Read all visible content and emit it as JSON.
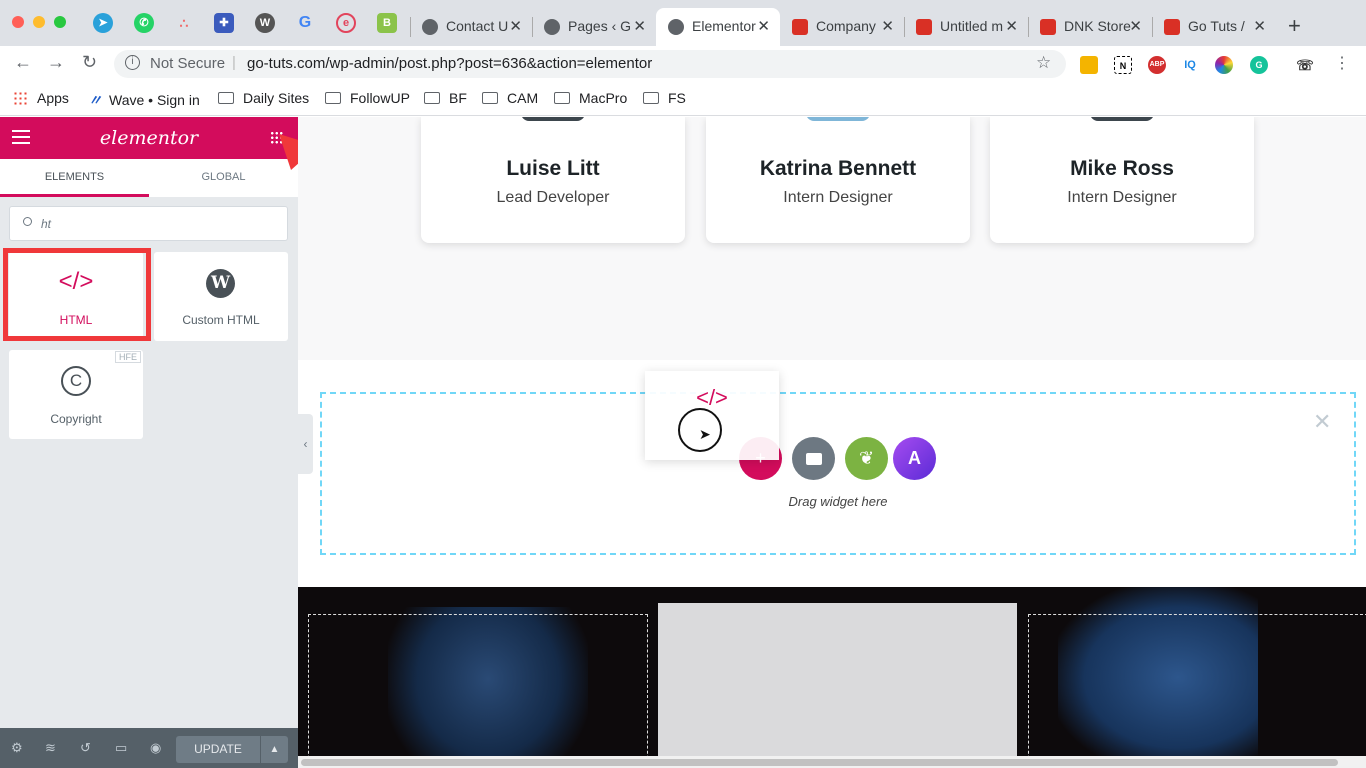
{
  "browser": {
    "tabs": [
      {
        "title": "Contact U",
        "kind": "globe"
      },
      {
        "title": "Pages ‹ G",
        "kind": "globe"
      },
      {
        "title": "Elementor",
        "kind": "globe",
        "active": true
      },
      {
        "title": "Company",
        "kind": "maps"
      },
      {
        "title": "Untitled m",
        "kind": "maps"
      },
      {
        "title": "DNK Store",
        "kind": "maps"
      },
      {
        "title": "Go Tuts /",
        "kind": "maps"
      }
    ],
    "security": "Not Secure",
    "url": "go-tuts.com/wp-admin/post.php?post=636&action=elementor",
    "bookmarks": [
      "Apps",
      "Wave • Sign in",
      "Daily Sites",
      "FollowUP",
      "BF",
      "CAM",
      "MacPro",
      "FS"
    ],
    "ext_labels": [
      "N",
      "ABP",
      "IQ"
    ]
  },
  "panel": {
    "logo": "elementor",
    "tabs": [
      "ELEMENTS",
      "GLOBAL"
    ],
    "search_value": "ht",
    "widgets": [
      {
        "label": "HTML",
        "icon": "code-icon",
        "highlighted": true
      },
      {
        "label": "Custom HTML",
        "icon": "wordpress-icon"
      },
      {
        "label": "Copyright",
        "icon": "copyright-icon",
        "badge": "HFE"
      }
    ],
    "footer": {
      "update_label": "UPDATE"
    }
  },
  "canvas": {
    "team": [
      {
        "name": "Luise Litt",
        "role": "Lead Developer"
      },
      {
        "name": "Katrina Bennett",
        "role": "Intern Designer"
      },
      {
        "name": "Mike Ross",
        "role": "Intern Designer"
      }
    ],
    "dropzone_text": "Drag widget here"
  },
  "colors": {
    "brand": "#d30c5c",
    "annotation": "#f0383a",
    "dropzone": "#71d7f7"
  }
}
